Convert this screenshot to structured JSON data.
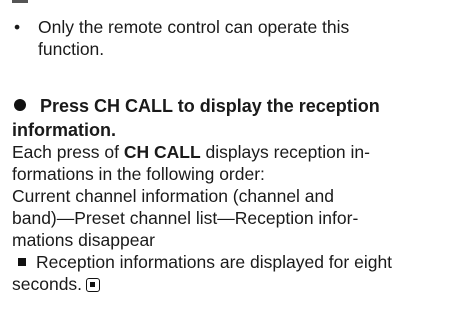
{
  "note": {
    "bullet": "•",
    "line1": "Only the remote control can operate this",
    "line2": "function."
  },
  "step": {
    "heading_line1": "Press CH CALL to display the reception",
    "heading_line2": "information."
  },
  "body": {
    "p1_prefix": "Each press of ",
    "p1_bold": "CH CALL",
    "p1_suffix": " displays reception in-",
    "p2": "formations in the following order:",
    "p3": "Current channel information (channel and",
    "p4": "band)—Preset channel list—Reception infor-",
    "p5": "mations disappear"
  },
  "tip": {
    "line1": "Reception informations are displayed for eight",
    "line2": "seconds."
  }
}
